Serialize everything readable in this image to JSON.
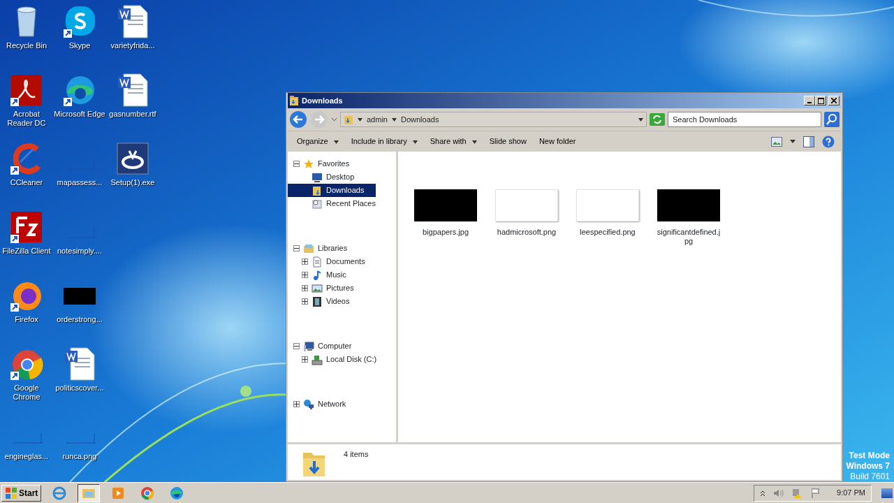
{
  "desktop": {
    "icons": [
      {
        "label": "Recycle Bin",
        "kind": "recycle",
        "shortcut": false
      },
      {
        "label": "Acrobat Reader DC",
        "kind": "acrobat",
        "shortcut": true
      },
      {
        "label": "CCleaner",
        "kind": "ccleaner",
        "shortcut": true
      },
      {
        "label": "FileZilla Client",
        "kind": "filezilla",
        "shortcut": true
      },
      {
        "label": "Firefox",
        "kind": "firefox",
        "shortcut": true
      },
      {
        "label": "Google Chrome",
        "kind": "chrome",
        "shortcut": true
      },
      {
        "label": "engineglas...",
        "kind": "blank",
        "shortcut": false
      },
      {
        "label": "Skype",
        "kind": "skype",
        "shortcut": true
      },
      {
        "label": "Microsoft Edge",
        "kind": "edge",
        "shortcut": true
      },
      {
        "label": "mapassess...",
        "kind": "blank",
        "shortcut": false
      },
      {
        "label": "notesimply....",
        "kind": "blank",
        "shortcut": false
      },
      {
        "label": "orderstrong...",
        "kind": "dark",
        "shortcut": false
      },
      {
        "label": "politicscover...",
        "kind": "word",
        "shortcut": false
      },
      {
        "label": "runca.png",
        "kind": "blank",
        "shortcut": false
      },
      {
        "label": "varietyfrida...",
        "kind": "word",
        "shortcut": false
      },
      {
        "label": "gasnumber.rtf",
        "kind": "word",
        "shortcut": false
      },
      {
        "label": "Setup(1).exe",
        "kind": "setup",
        "shortcut": false
      }
    ],
    "watermark_lines": [
      "Test Mode",
      "Windows 7",
      "Build 7601"
    ]
  },
  "window": {
    "title": "Downloads",
    "back": {
      "disabled": false
    },
    "forward": {
      "disabled": true
    },
    "breadcrumb": [
      "admin",
      "Downloads"
    ],
    "search": {
      "placeholder": "Search Downloads"
    },
    "toolbar": [
      {
        "label": "Organize",
        "dropdown": true
      },
      {
        "label": "Include in library",
        "dropdown": true
      },
      {
        "label": "Share with",
        "dropdown": true
      },
      {
        "label": "Slide show",
        "dropdown": false
      },
      {
        "label": "New folder",
        "dropdown": false
      }
    ],
    "tree": [
      {
        "label": "Favorites",
        "kind": "favorites",
        "expanded": true,
        "selected": false,
        "children": [
          {
            "label": "Desktop",
            "kind": "desktop",
            "selected": false
          },
          {
            "label": "Downloads",
            "kind": "downloads",
            "selected": true
          },
          {
            "label": "Recent Places",
            "kind": "recent",
            "selected": false
          }
        ]
      },
      {
        "label": "Libraries",
        "kind": "libraries",
        "expanded": true,
        "selected": false,
        "children": [
          {
            "label": "Documents",
            "kind": "documents",
            "expanded": false,
            "selected": false
          },
          {
            "label": "Music",
            "kind": "music",
            "expanded": false,
            "selected": false
          },
          {
            "label": "Pictures",
            "kind": "pictures",
            "expanded": false,
            "selected": false
          },
          {
            "label": "Videos",
            "kind": "videos",
            "expanded": false,
            "selected": false
          }
        ]
      },
      {
        "label": "Computer",
        "kind": "computer",
        "expanded": true,
        "selected": false,
        "children": [
          {
            "label": "Local Disk (C:)",
            "kind": "disk",
            "expanded": false,
            "selected": false
          }
        ]
      },
      {
        "label": "Network",
        "kind": "network",
        "expanded": false,
        "selected": false
      }
    ],
    "files": [
      {
        "name": "bigpapers.jpg",
        "kind": "dark"
      },
      {
        "name": "hadmicrosoft.png",
        "kind": "light"
      },
      {
        "name": "leespecified.png",
        "kind": "light"
      },
      {
        "name": "significantdefined.jpg",
        "kind": "dark"
      }
    ],
    "status": "4 items"
  },
  "taskbar": {
    "start": "Start",
    "items": [
      {
        "kind": "ie",
        "selected": false
      },
      {
        "kind": "explorer",
        "selected": true
      },
      {
        "kind": "media",
        "selected": false
      },
      {
        "kind": "chrome",
        "selected": false
      },
      {
        "kind": "edge",
        "selected": false
      }
    ],
    "time": "9:07 PM"
  }
}
